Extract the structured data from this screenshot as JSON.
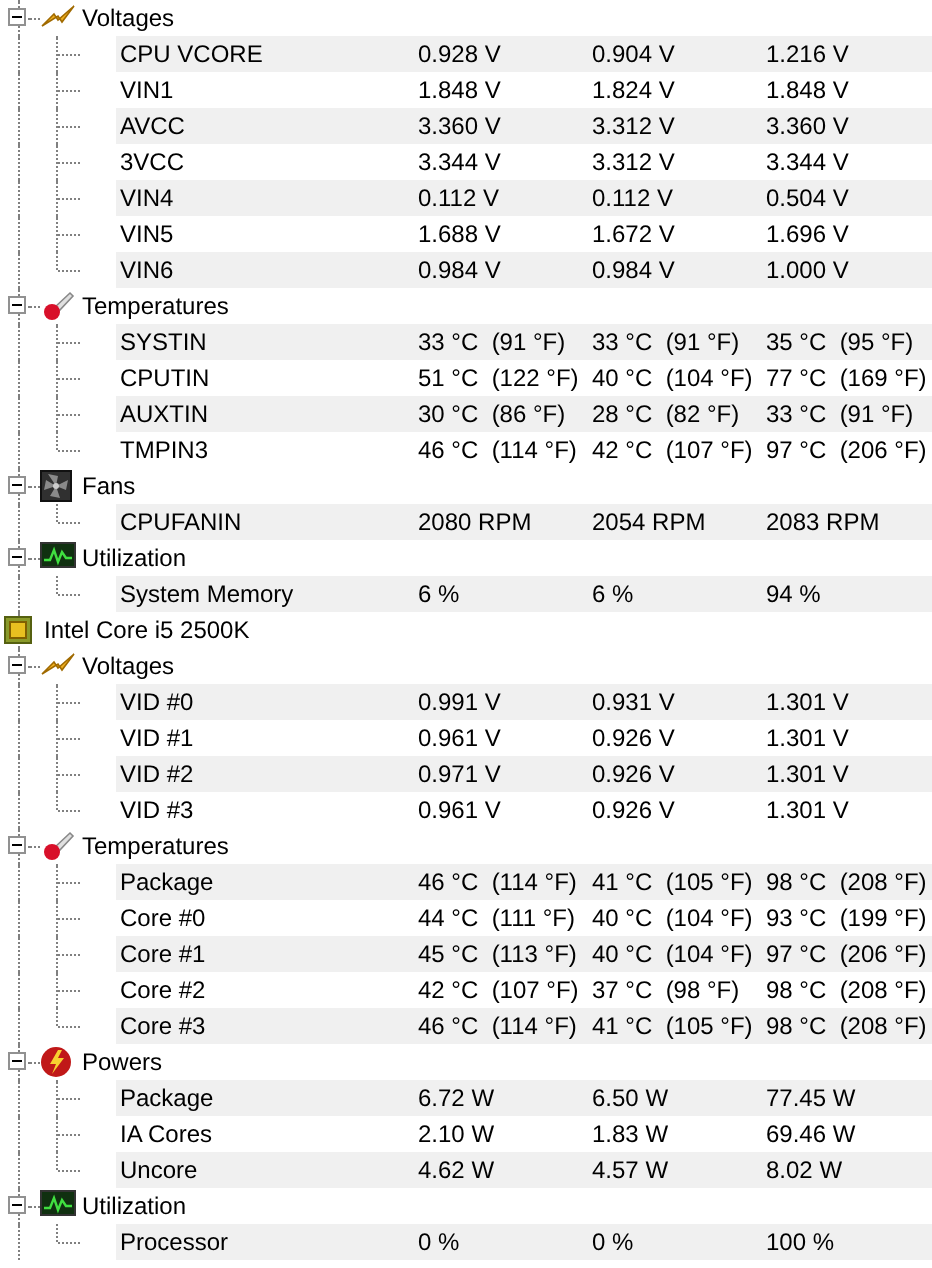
{
  "continued_groups": [
    {
      "kind": "voltages",
      "label": "Voltages",
      "expanded": true,
      "sensors": [
        {
          "name": "CPU VCORE",
          "value": "0.928 V",
          "min": "0.904 V",
          "max": "1.216 V"
        },
        {
          "name": "VIN1",
          "value": "1.848 V",
          "min": "1.824 V",
          "max": "1.848 V"
        },
        {
          "name": "AVCC",
          "value": "3.360 V",
          "min": "3.312 V",
          "max": "3.360 V"
        },
        {
          "name": "3VCC",
          "value": "3.344 V",
          "min": "3.312 V",
          "max": "3.344 V"
        },
        {
          "name": "VIN4",
          "value": "0.112 V",
          "min": "0.112 V",
          "max": "0.504 V"
        },
        {
          "name": "VIN5",
          "value": "1.688 V",
          "min": "1.672 V",
          "max": "1.696 V"
        },
        {
          "name": "VIN6",
          "value": "0.984 V",
          "min": "0.984 V",
          "max": "1.000 V"
        }
      ]
    },
    {
      "kind": "temperatures",
      "label": "Temperatures",
      "expanded": true,
      "sensors": [
        {
          "name": "SYSTIN",
          "value": "33 °C  (91 °F)",
          "min": "33 °C  (91 °F)",
          "max": "35 °C  (95 °F)"
        },
        {
          "name": "CPUTIN",
          "value": "51 °C  (122 °F)",
          "min": "40 °C  (104 °F)",
          "max": "77 °C  (169 °F)"
        },
        {
          "name": "AUXTIN",
          "value": "30 °C  (86 °F)",
          "min": "28 °C  (82 °F)",
          "max": "33 °C  (91 °F)"
        },
        {
          "name": "TMPIN3",
          "value": "46 °C  (114 °F)",
          "min": "42 °C  (107 °F)",
          "max": "97 °C  (206 °F)"
        }
      ]
    },
    {
      "kind": "fans",
      "label": "Fans",
      "expanded": true,
      "sensors": [
        {
          "name": "CPUFANIN",
          "value": "2080 RPM",
          "min": "2054 RPM",
          "max": "2083 RPM"
        }
      ]
    },
    {
      "kind": "utilization",
      "label": "Utilization",
      "expanded": true,
      "sensors": [
        {
          "name": "System Memory",
          "value": "6 %",
          "min": "6 %",
          "max": "94 %"
        }
      ]
    }
  ],
  "devices": [
    {
      "name": "Intel Core i5 2500K",
      "groups": [
        {
          "kind": "voltages",
          "label": "Voltages",
          "expanded": true,
          "sensors": [
            {
              "name": "VID #0",
              "value": "0.991 V",
              "min": "0.931 V",
              "max": "1.301 V"
            },
            {
              "name": "VID #1",
              "value": "0.961 V",
              "min": "0.926 V",
              "max": "1.301 V"
            },
            {
              "name": "VID #2",
              "value": "0.971 V",
              "min": "0.926 V",
              "max": "1.301 V"
            },
            {
              "name": "VID #3",
              "value": "0.961 V",
              "min": "0.926 V",
              "max": "1.301 V"
            }
          ]
        },
        {
          "kind": "temperatures",
          "label": "Temperatures",
          "expanded": true,
          "sensors": [
            {
              "name": "Package",
              "value": "46 °C  (114 °F)",
              "min": "41 °C  (105 °F)",
              "max": "98 °C  (208 °F)"
            },
            {
              "name": "Core #0",
              "value": "44 °C  (111 °F)",
              "min": "40 °C  (104 °F)",
              "max": "93 °C  (199 °F)"
            },
            {
              "name": "Core #1",
              "value": "45 °C  (113 °F)",
              "min": "40 °C  (104 °F)",
              "max": "97 °C  (206 °F)"
            },
            {
              "name": "Core #2",
              "value": "42 °C  (107 °F)",
              "min": "37 °C  (98 °F)",
              "max": "98 °C  (208 °F)"
            },
            {
              "name": "Core #3",
              "value": "46 °C  (114 °F)",
              "min": "41 °C  (105 °F)",
              "max": "98 °C  (208 °F)"
            }
          ]
        },
        {
          "kind": "powers",
          "label": "Powers",
          "expanded": true,
          "sensors": [
            {
              "name": "Package",
              "value": "6.72 W",
              "min": "6.50 W",
              "max": "77.45 W"
            },
            {
              "name": "IA Cores",
              "value": "2.10 W",
              "min": "1.83 W",
              "max": "69.46 W"
            },
            {
              "name": "Uncore",
              "value": "4.62 W",
              "min": "4.57 W",
              "max": "8.02 W"
            }
          ]
        },
        {
          "kind": "utilization",
          "label": "Utilization",
          "expanded": true,
          "sensors": [
            {
              "name": "Processor",
              "value": "0 %",
              "min": "0 %",
              "max": "100 %"
            }
          ]
        }
      ]
    }
  ]
}
